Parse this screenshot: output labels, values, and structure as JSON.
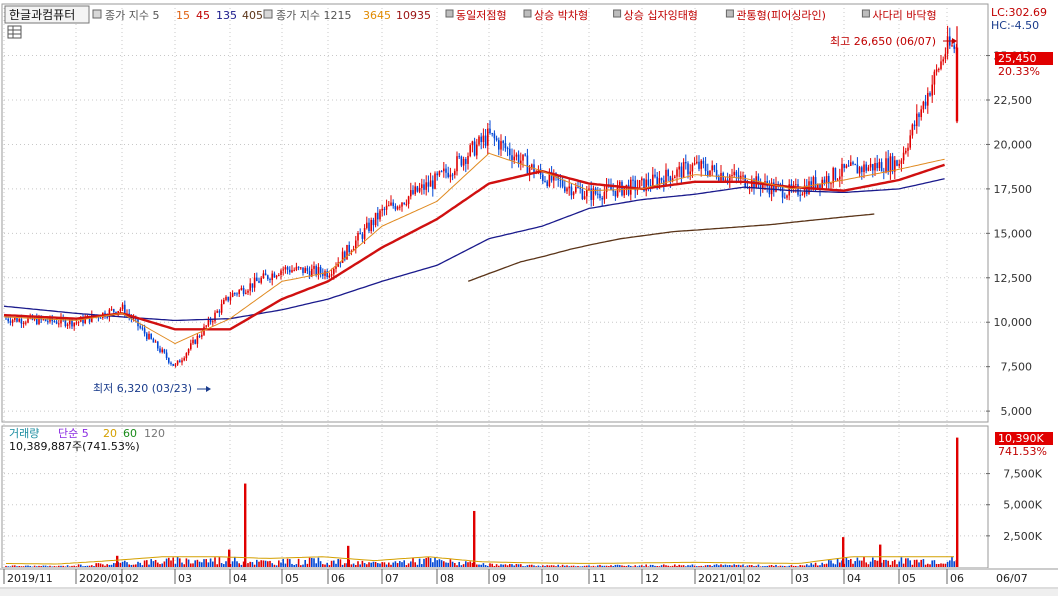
{
  "header": {
    "stock_name": "한글과컴퓨터",
    "ma_label": "종가 지수 5",
    "ma_periods": [
      "15",
      "45",
      "135",
      "405"
    ],
    "ma_colors": [
      "#e06010",
      "#c00000",
      "#1a1a8c",
      "#5a3418"
    ],
    "ma2_label": "종가 지수 1215",
    "ma2_periods": [
      "3645",
      "10935"
    ],
    "ma2_colors": [
      "#e08a00",
      "#9a1010"
    ],
    "patterns": [
      {
        "label": "동일저점형",
        "color": "#c00000"
      },
      {
        "label": "상승 박차형",
        "color": "#c00000"
      },
      {
        "label": "상승 십자잉태형",
        "color": "#c00000"
      },
      {
        "label": "관통형(피어싱라인)",
        "color": "#c00000"
      },
      {
        "label": "사다리 바닥형",
        "color": "#c00000"
      }
    ],
    "lc": "LC:302.69",
    "hc": "HC:-4.50"
  },
  "price_panel": {
    "high_annotation": "최고 26,650 (06/07)",
    "low_annotation": "최저 6,320 (03/23)",
    "current_price": "25,450",
    "current_change": "20.33%",
    "y_ticks": [
      "25,000",
      "22,500",
      "20,000",
      "17,500",
      "15,000",
      "12,500",
      "10,000",
      "7,500",
      "5,000"
    ]
  },
  "volume_panel": {
    "label": "거래량",
    "ma_label": "단순 5",
    "ma_periods": [
      "20",
      "60",
      "120"
    ],
    "ma_colors": [
      "#8a2be2",
      "#d4a000",
      "#1a8c1a",
      "#777777"
    ],
    "volume_text": "10,389,887주(741.53%)",
    "current_volume": "10,390K",
    "current_change": "741.53%",
    "y_ticks": [
      "7,500K",
      "5,000K",
      "2,500K"
    ]
  },
  "x_axis": {
    "labels": [
      "2019/11",
      "2020/01",
      "02",
      "03",
      "04",
      "05",
      "06",
      "07",
      "08",
      "09",
      "10",
      "11",
      "12",
      "2021/01",
      "02",
      "03",
      "04",
      "05",
      "06",
      "06/07"
    ]
  },
  "colors": {
    "up": "#e00000",
    "down": "#0046d5",
    "grid": "#c8c8c8",
    "badge_bg": "#e00000"
  },
  "chart_data": {
    "type": "candlestick",
    "price_range": [
      4500,
      27000
    ],
    "volume_range": [
      0,
      11000
    ],
    "x_unit": "month",
    "x": [
      "2019/11",
      "2020/01",
      "2020/02",
      "2020/03",
      "2020/04",
      "2020/05",
      "2020/06",
      "2020/07",
      "2020/08",
      "2020/09",
      "2020/10",
      "2020/11",
      "2020/12",
      "2021/01",
      "2021/02",
      "2021/03",
      "2021/04",
      "2021/05",
      "2021/06"
    ],
    "close": [
      10200,
      10000,
      10800,
      7500,
      11500,
      13000,
      12800,
      16200,
      18000,
      20500,
      18200,
      17200,
      17700,
      18800,
      18000,
      17300,
      18500,
      19000,
      25450
    ],
    "ma_fast_weekly": [
      10300,
      10100,
      10500,
      8800,
      10200,
      12300,
      12800,
      15400,
      16800,
      19500,
      18500,
      17400,
      17500,
      18300,
      18100,
      17500,
      18000,
      18600,
      19200
    ],
    "ma_red": [
      10400,
      10200,
      10500,
      9600,
      9600,
      11300,
      12300,
      14200,
      15800,
      17800,
      18500,
      17800,
      17500,
      17900,
      17900,
      17600,
      17400,
      18000,
      18900
    ],
    "ma_blue": [
      10900,
      10500,
      10300,
      10100,
      10200,
      10700,
      11300,
      12300,
      13200,
      14700,
      15400,
      16400,
      16900,
      17200,
      17600,
      17400,
      17300,
      17500,
      18100
    ],
    "ma_brown_start": "2020/08",
    "ma_brown": [
      12300,
      13400,
      14100,
      14700,
      15100,
      15300,
      15500,
      15800,
      16100
    ],
    "volume_k": [
      300,
      200,
      800,
      1500,
      2200,
      1200,
      1500,
      800,
      4500,
      600,
      400,
      300,
      400,
      500,
      400,
      300,
      3500,
      1500,
      10390
    ],
    "series": [
      {
        "name": "15",
        "color": "#e06010"
      },
      {
        "name": "45",
        "color": "#c00000"
      },
      {
        "name": "135",
        "color": "#1a1a8c"
      },
      {
        "name": "405",
        "color": "#5a3418"
      }
    ],
    "annotations": [
      {
        "text": "최고 26,650 (06/07)",
        "x": "2021/06/07",
        "y": 26650
      },
      {
        "text": "최저 6,320 (03/23)",
        "x": "2020/03/23",
        "y": 6320
      }
    ]
  }
}
